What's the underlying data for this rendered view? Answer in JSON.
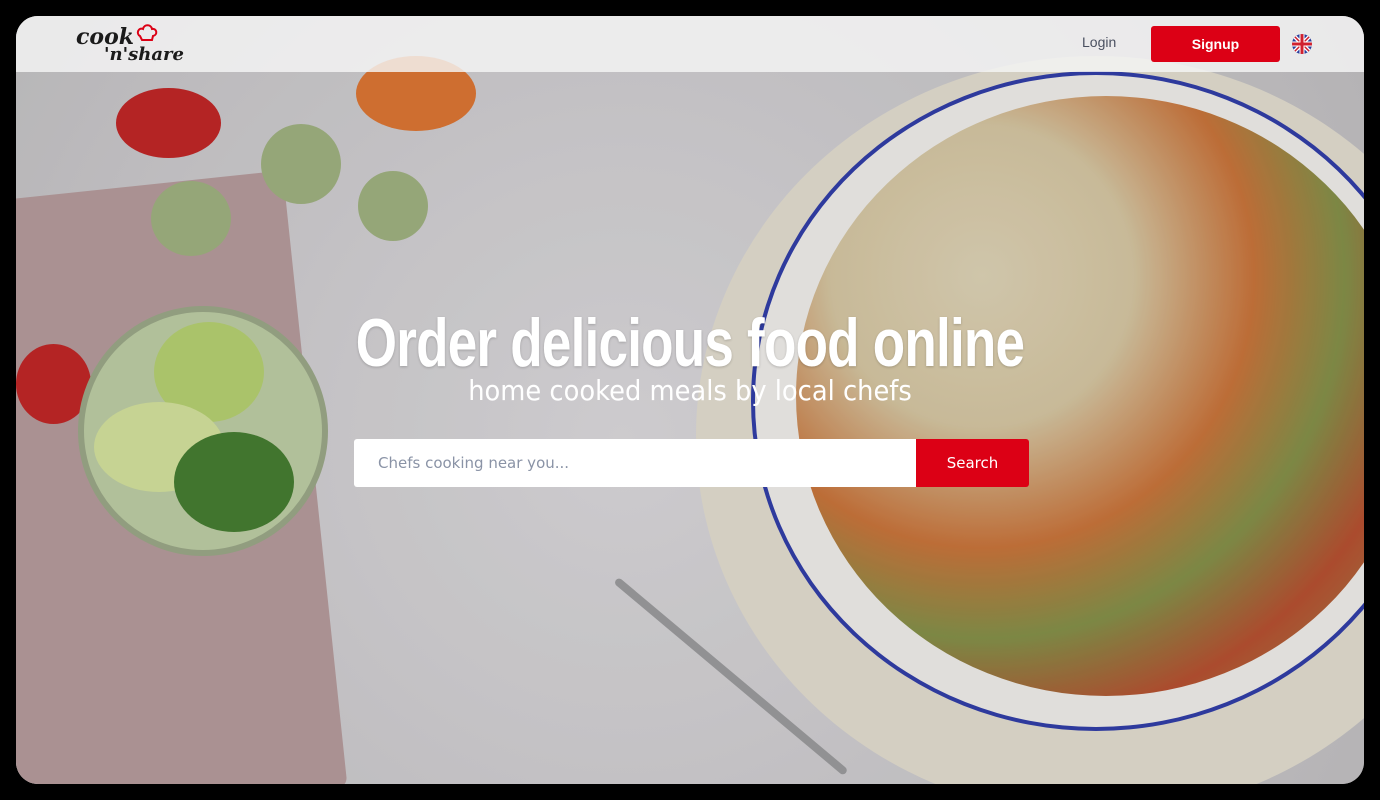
{
  "header": {
    "logo_text": "cook 'n' share",
    "login_label": "Login",
    "signup_label": "Signup",
    "language": "English"
  },
  "hero": {
    "title": "Order delicious food online",
    "subtitle": "home cooked meals by local chefs"
  },
  "search": {
    "placeholder": "Chefs cooking near you...",
    "value": "",
    "button_label": "Search"
  },
  "colors": {
    "accent": "#dc0015"
  }
}
